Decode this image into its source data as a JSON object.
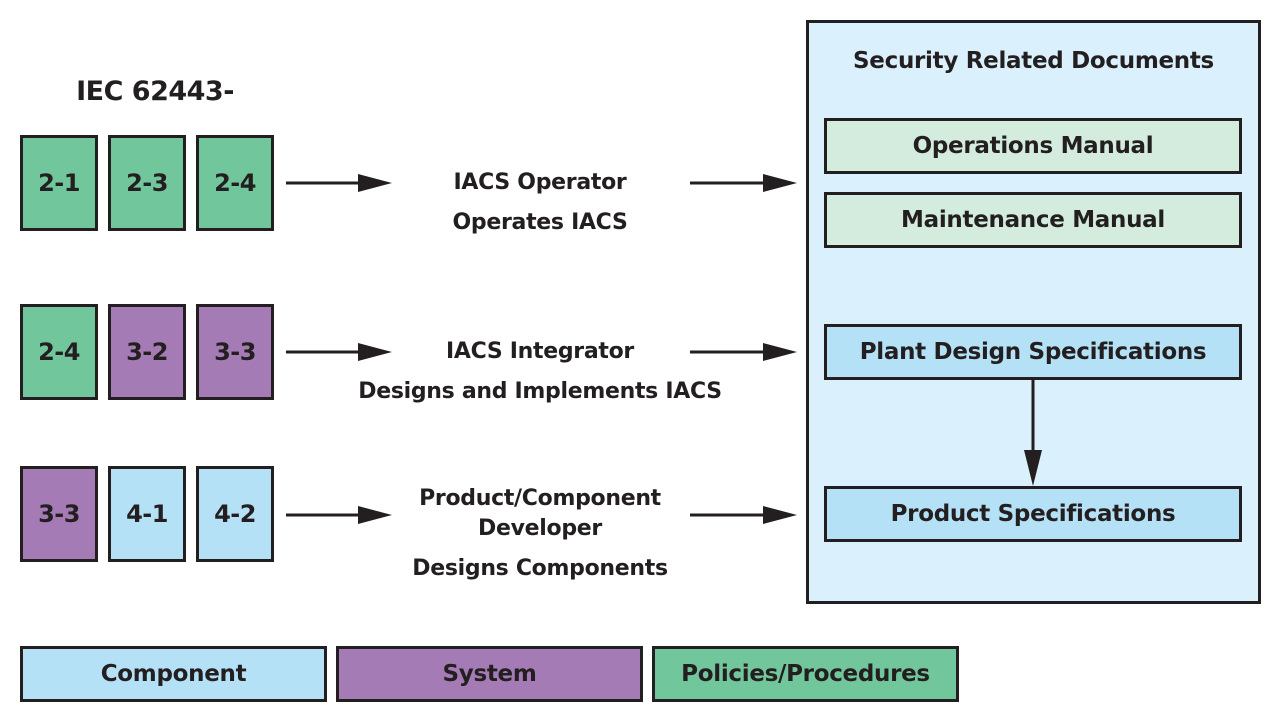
{
  "standard_title": "IEC 62443-",
  "rows": [
    {
      "parts": [
        {
          "label": "2-1",
          "category": "policies"
        },
        {
          "label": "2-3",
          "category": "policies"
        },
        {
          "label": "2-4",
          "category": "policies"
        }
      ],
      "role": {
        "line1": "IACS Operator",
        "line2": "Operates IACS"
      }
    },
    {
      "parts": [
        {
          "label": "2-4",
          "category": "policies"
        },
        {
          "label": "3-2",
          "category": "system"
        },
        {
          "label": "3-3",
          "category": "system"
        }
      ],
      "role": {
        "line1": "IACS Integrator",
        "line2": "Designs and Implements IACS"
      }
    },
    {
      "parts": [
        {
          "label": "3-3",
          "category": "system"
        },
        {
          "label": "4-1",
          "category": "component"
        },
        {
          "label": "4-2",
          "category": "component"
        }
      ],
      "role": {
        "line1": "Product/Component",
        "line1b": "Developer",
        "line2": "Designs Components"
      }
    }
  ],
  "documents": {
    "title": "Security Related Documents",
    "items": [
      {
        "label": "Operations Manual"
      },
      {
        "label": "Maintenance Manual"
      },
      {
        "label": "Plant Design Specifications"
      },
      {
        "label": "Product Specifications"
      }
    ]
  },
  "legend": [
    {
      "label": "Component",
      "color": "#b5e1f7"
    },
    {
      "label": "System",
      "color": "#a57bb6"
    },
    {
      "label": "Policies/Procedures",
      "color": "#72c69c"
    }
  ],
  "colors": {
    "policies": "#72c69c",
    "system": "#a57bb6",
    "component": "#b5e1f7",
    "manual": "#d3ecdd",
    "docs_panel": "#daf0fc",
    "outline": "#231f20"
  }
}
